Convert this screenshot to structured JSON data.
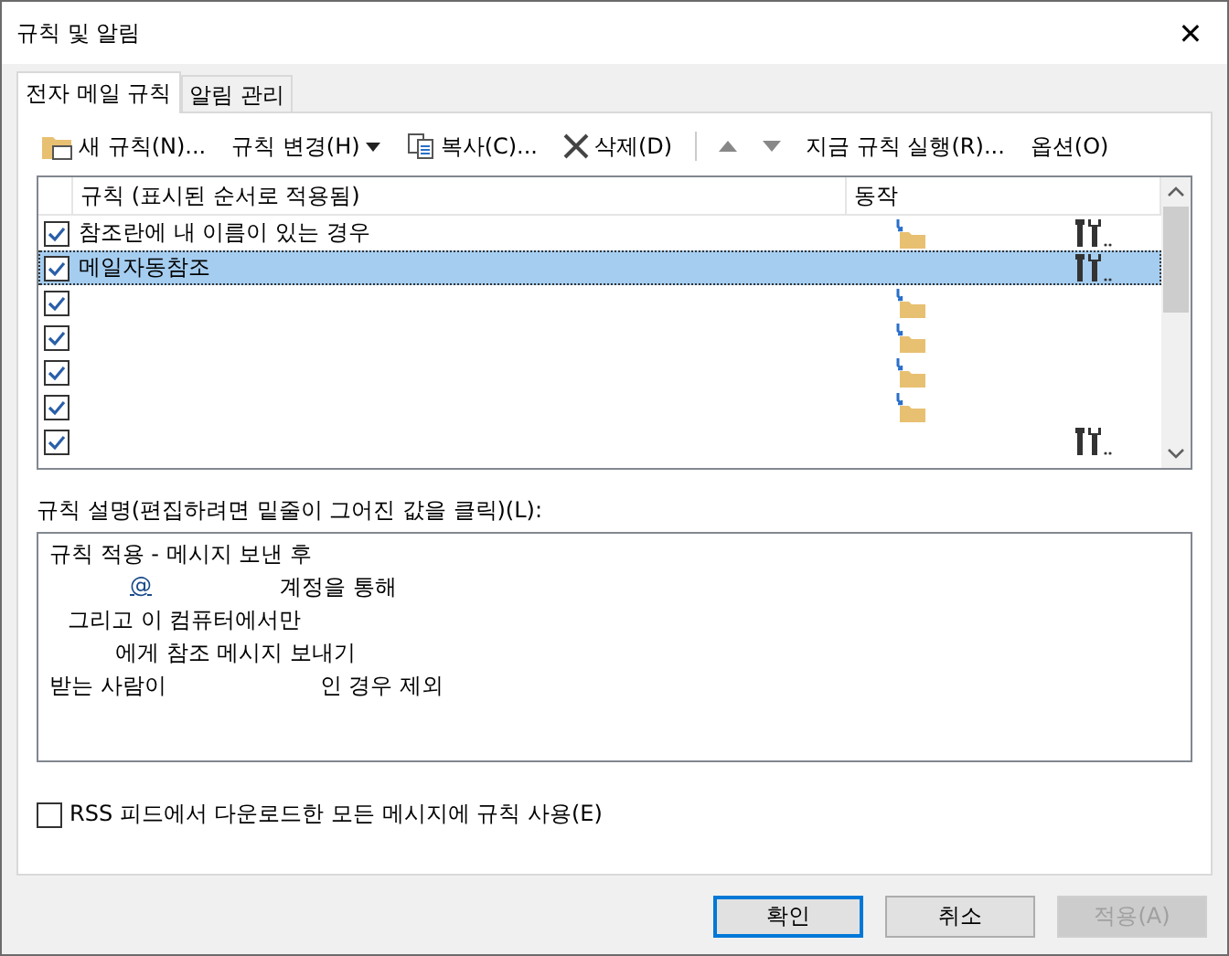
{
  "window": {
    "title": "규칙 및 알림",
    "close": "✕"
  },
  "tabs": [
    {
      "label": "전자 메일 규칙",
      "selected": true
    },
    {
      "label": "알림 관리",
      "selected": false
    }
  ],
  "toolbar": [
    {
      "kind": "new",
      "label": "새 규칙(N)..."
    },
    {
      "kind": "menu",
      "label": "규칙 변경(H)"
    },
    {
      "kind": "copy",
      "label": "복사(C)..."
    },
    {
      "kind": "delete",
      "label": "삭제(D)"
    },
    {
      "kind": "up"
    },
    {
      "kind": "down"
    },
    {
      "kind": "plain",
      "label": "지금 규칙 실행(R)..."
    },
    {
      "kind": "plain",
      "label": "옵션(O)"
    }
  ],
  "rules_list": {
    "columns": [
      "규칙 (표시된 순서로 적용됨)",
      "동작"
    ],
    "rows": [
      {
        "checked": true,
        "name": "참조란에 내 이름이 있는 경우",
        "selected": false,
        "folder": true,
        "tools": true
      },
      {
        "checked": true,
        "name": "메일자동참조",
        "selected": true,
        "folder": false,
        "tools": true
      },
      {
        "checked": true,
        "selected": false,
        "folder": true,
        "tools": false
      },
      {
        "checked": true,
        "selected": false,
        "folder": true,
        "tools": false
      },
      {
        "checked": true,
        "selected": false,
        "folder": true,
        "tools": false
      },
      {
        "checked": true,
        "selected": false,
        "folder": true,
        "tools": false
      },
      {
        "checked": true,
        "selected": false,
        "folder": false,
        "tools": true
      }
    ]
  },
  "description": {
    "label": "규칙 설명(편집하려면 밑줄이 그어진 값을 클릭)(L):",
    "lines": [
      [
        {
          "kind": "text",
          "text": "규칙 적용 - 메시지 보낸 후"
        }
      ],
      [
        {
          "kind": "link",
          "text": "@"
        },
        {
          "kind": "text",
          "text": "계정을 통해"
        }
      ],
      [
        {
          "kind": "text",
          "text": "그리고 이 컴퓨터에서만"
        }
      ],
      [
        {
          "kind": "text",
          "text": "에게 참조 메시지 보내기"
        }
      ],
      [
        {
          "kind": "text",
          "text": "받는 사람이"
        },
        {
          "kind": "text",
          "text": "인 경우 제외"
        }
      ]
    ]
  },
  "rss_option": {
    "label": "RSS 피드에서 다운로드한 모든 메시지에 규칙 사용(E)",
    "checked": false
  },
  "buttons": [
    {
      "label": "확인",
      "kind": "default"
    },
    {
      "label": "취소",
      "kind": "normal"
    },
    {
      "label": "적용(A)",
      "kind": "disabled"
    }
  ]
}
